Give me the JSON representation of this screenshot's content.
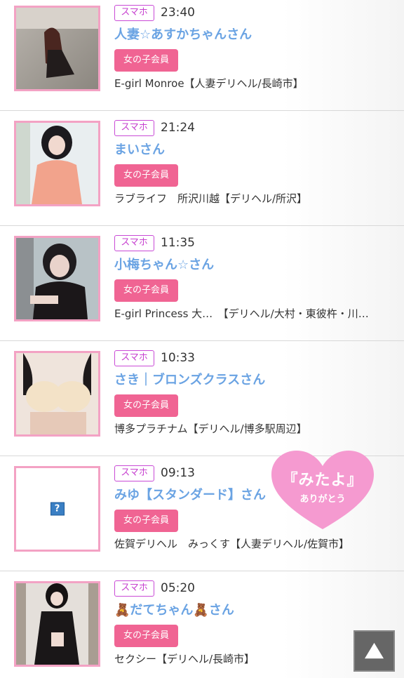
{
  "badge_label": "スマホ",
  "member_label": "女の子会員",
  "entries": [
    {
      "time": "23:40",
      "name": "人妻☆あすかちゃんさん",
      "shop": "E-girl Monroe【人妻デリヘル/長崎市】",
      "photo_icon": "photo-outdoor"
    },
    {
      "time": "21:24",
      "name": "まいさん",
      "shop": "ラブライフ　所沢川越【デリヘル/所沢】",
      "photo_icon": "photo-pink-dress"
    },
    {
      "time": "11:35",
      "name": "小梅ちゃん☆さん",
      "shop": "E-girl Princess 大…　【デリヘル/大村・東彼杵・川…",
      "photo_icon": "photo-cat-ears"
    },
    {
      "time": "10:33",
      "name": "さき｜ブロンズクラスさん",
      "shop": "博多プラチナム【デリヘル/博多駅周辺】",
      "photo_icon": "photo-lace"
    },
    {
      "time": "09:13",
      "name": "みゆ【スタンダード】さん",
      "shop": "佐賀デリヘル　みっくす【人妻デリヘル/佐賀市】",
      "photo_icon": "missing-image-icon"
    },
    {
      "time": "05:20",
      "name": "🧸だてちゃん🧸さん",
      "shop": "セクシー【デリヘル/長崎市】",
      "photo_icon": "photo-black-lingerie"
    }
  ],
  "heart_badge": {
    "line1": "『みたよ』",
    "line2": "ありがとう",
    "color": "#f59ad0"
  },
  "missing_image_glyph": "?",
  "colors": {
    "badge_border": "#c94ad6",
    "name": "#6aa3e3",
    "member_bg": "#f06493",
    "thumb_border": "#f3a2c4"
  }
}
